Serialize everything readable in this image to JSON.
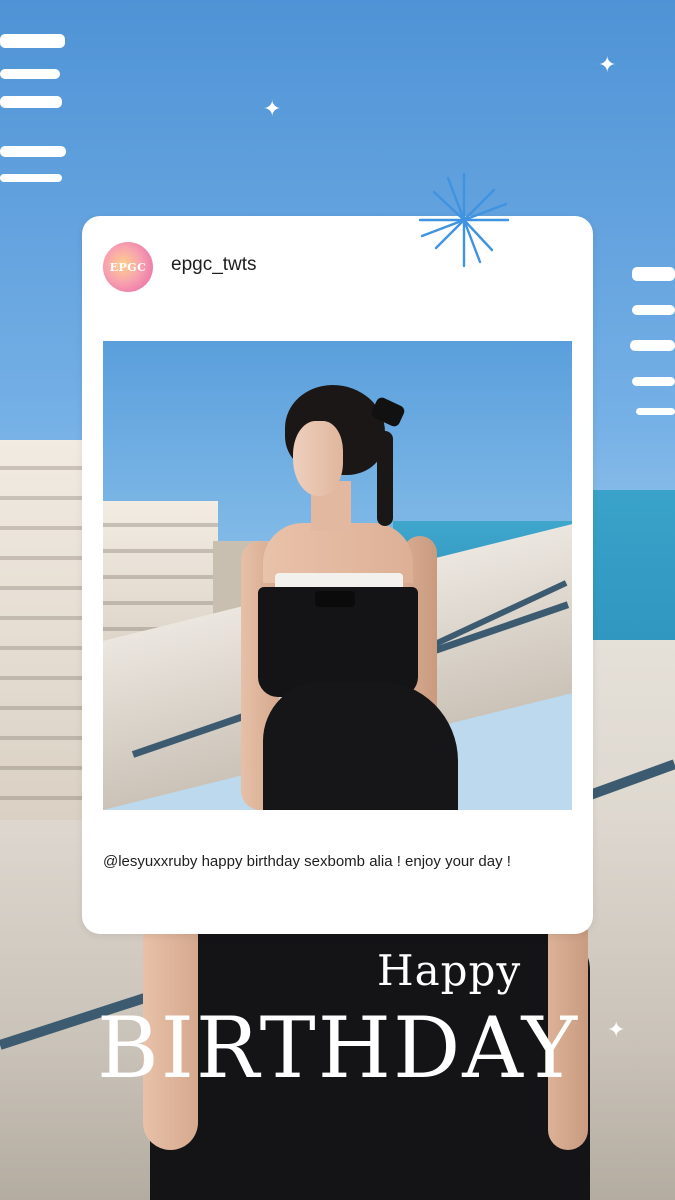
{
  "post": {
    "username": "epgc_twts",
    "avatar_text": "EPGC",
    "caption": "@lesyuxxruby happy birthday sexbomb alia ! enjoy your day !"
  },
  "overlay": {
    "happy": "Happy",
    "birthday": "BIRTHDAY"
  },
  "decor": {
    "sparkle_icon": "sparkle-icon",
    "starburst_icon": "starburst-icon",
    "stripe_color": "#ffffff",
    "starburst_color": "#3f93e0"
  }
}
